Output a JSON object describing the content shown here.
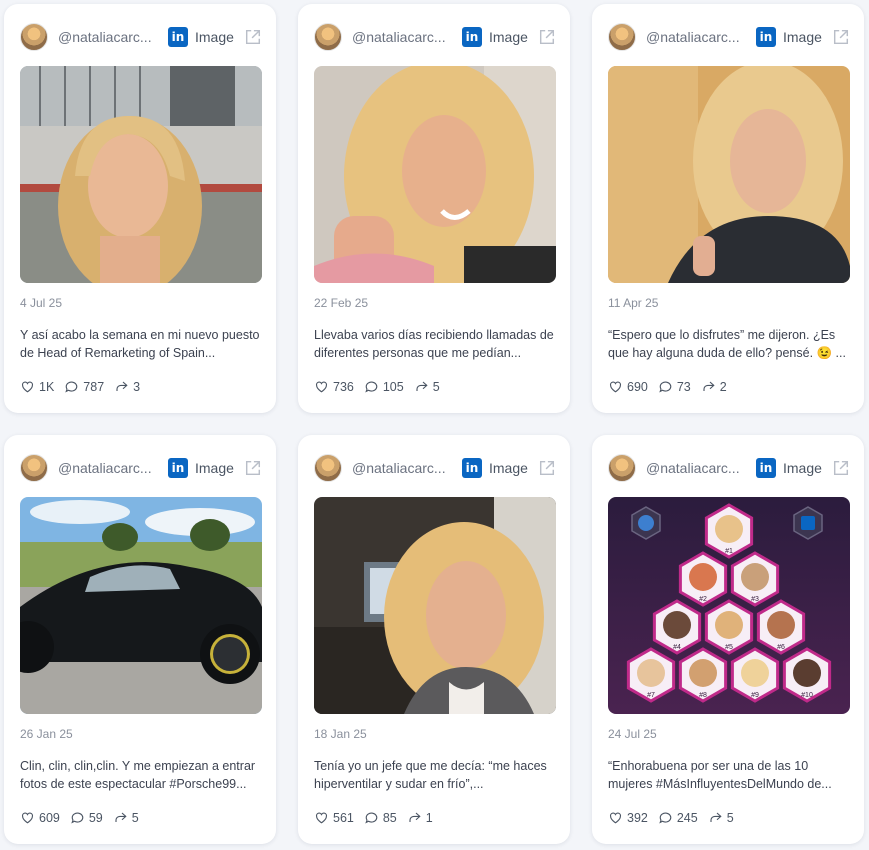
{
  "cards": [
    {
      "handle": "@nataliacarc...",
      "platform_icon": "linkedin-icon",
      "type": "Image",
      "date": "4 Jul 25",
      "caption": "Y así acabo la semana en mi nuevo puesto de Head of Remarketing of Spain...",
      "likes": "1K",
      "comments": "787",
      "shares": "3"
    },
    {
      "handle": "@nataliacarc...",
      "platform_icon": "linkedin-icon",
      "type": "Image",
      "date": "22 Feb 25",
      "caption": "Llevaba varios días recibiendo llamadas de diferentes personas que me pedían...",
      "likes": "736",
      "comments": "105",
      "shares": "5"
    },
    {
      "handle": "@nataliacarc...",
      "platform_icon": "linkedin-icon",
      "type": "Image",
      "date": "11 Apr 25",
      "caption": "“Espero que lo disfrutes” me dijeron. ¿Es que hay alguna duda de ello? pensé. 😉 ...",
      "likes": "690",
      "comments": "73",
      "shares": "2"
    },
    {
      "handle": "@nataliacarc...",
      "platform_icon": "linkedin-icon",
      "type": "Image",
      "date": "26 Jan 25",
      "caption": "Clin, clin, clin,clin. Y me empiezan a entrar fotos de este espectacular #Porsche99...",
      "likes": "609",
      "comments": "59",
      "shares": "5"
    },
    {
      "handle": "@nataliacarc...",
      "platform_icon": "linkedin-icon",
      "type": "Image",
      "date": "18 Jan 25",
      "caption": "Tenía yo un jefe que me decía: “me haces hiperventilar y sudar en frío”,...",
      "likes": "561",
      "comments": "85",
      "shares": "1"
    },
    {
      "handle": "@nataliacarc...",
      "platform_icon": "linkedin-icon",
      "type": "Image",
      "date": "24 Jul 25",
      "caption": "“Enhorabuena por ser una de las 10 mujeres #MásInfluyentesDelMundo de...",
      "likes": "392",
      "comments": "245",
      "shares": "5"
    }
  ],
  "ranking_badges": [
    "#1",
    "#2",
    "#3",
    "#4",
    "#5",
    "#6",
    "#7",
    "#8",
    "#9",
    "#10"
  ],
  "colors": {
    "linkedin": "#0a66c2",
    "card_bg": "#ffffff",
    "page_bg": "#f3f5f9"
  }
}
